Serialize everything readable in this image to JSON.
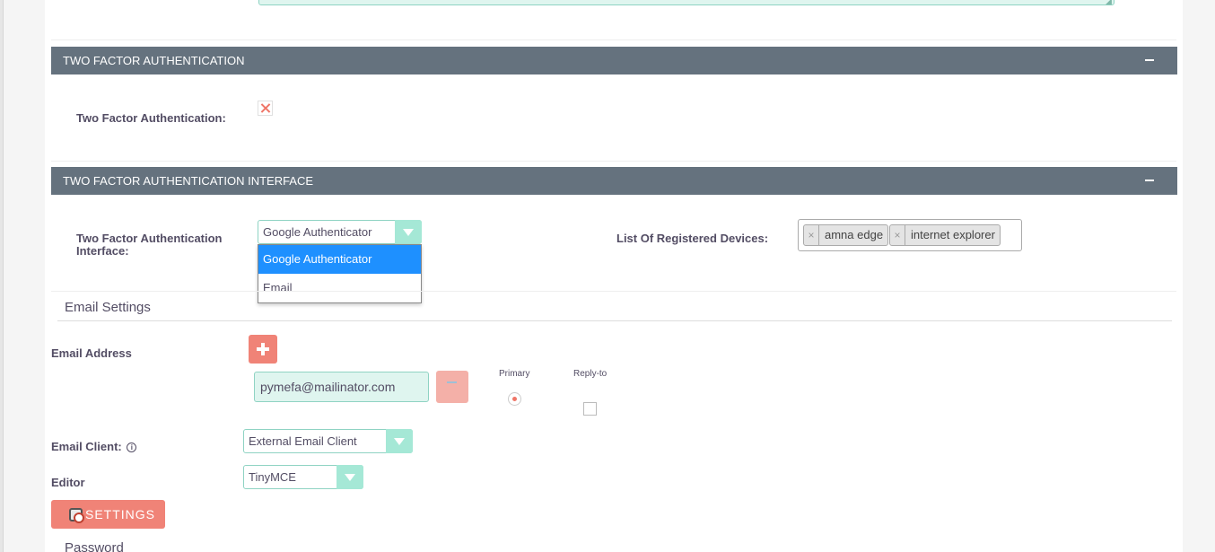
{
  "sections": {
    "two_factor": {
      "title": "TWO FACTOR AUTHENTICATION",
      "field_label": "Two Factor Authentication:"
    },
    "two_factor_interface": {
      "title": "TWO FACTOR AUTHENTICATION INTERFACE",
      "interface_label_line1": "Two Factor Authentication",
      "interface_label_line2": "Interface:",
      "interface_selected": "Google Authenticator",
      "interface_options": [
        "Google Authenticator",
        "Email"
      ],
      "devices_label": "List Of Registered Devices:",
      "devices": [
        "amna edge",
        "internet explorer"
      ]
    }
  },
  "email_settings": {
    "title": "Email Settings",
    "email_address_label": "Email Address",
    "email_value": "pymefa@mailinator.com",
    "primary_label": "Primary",
    "reply_to_label": "Reply-to",
    "email_client_label": "Email Client:",
    "email_client_value": "External Email Client",
    "editor_label": "Editor",
    "editor_value": "TinyMCE",
    "settings_button": "SETTINGS",
    "info_glyph": "i"
  },
  "password_title": "Password",
  "colors": {
    "section_header": "#65727e",
    "accent_red": "#f08377",
    "accent_teal": "#a5e8d6",
    "dropdown_active": "#1e90ff"
  }
}
